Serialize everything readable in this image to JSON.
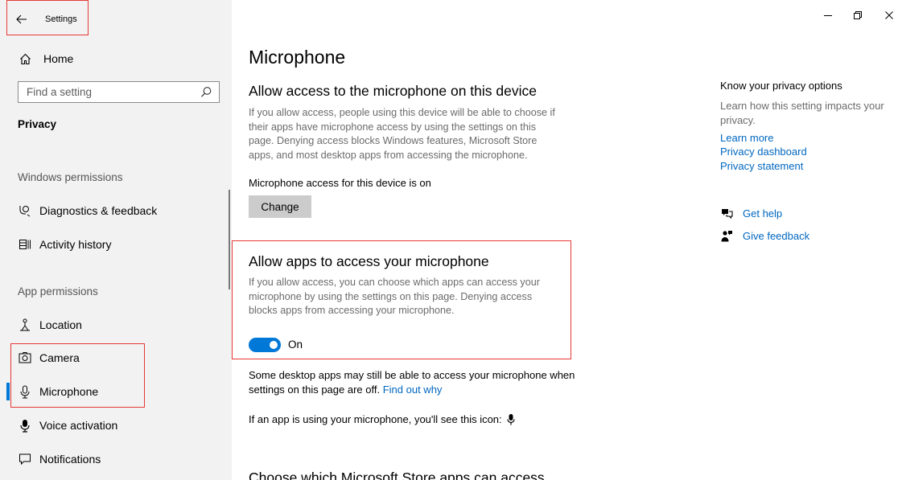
{
  "window": {
    "title": "Settings",
    "back_icon": "back-arrow-icon",
    "controls": [
      "minimize-icon",
      "restore-icon",
      "close-icon"
    ]
  },
  "sidebar": {
    "home_label": "Home",
    "search_placeholder": "Find a setting",
    "section_title": "Privacy",
    "groups": [
      {
        "label": "Windows permissions",
        "items": [
          {
            "label": "Diagnostics & feedback",
            "icon": "diagnostics-icon"
          },
          {
            "label": "Activity history",
            "icon": "activity-history-icon"
          }
        ]
      },
      {
        "label": "App permissions",
        "items": [
          {
            "label": "Location",
            "icon": "location-icon"
          },
          {
            "label": "Camera",
            "icon": "camera-icon"
          },
          {
            "label": "Microphone",
            "icon": "microphone-icon",
            "selected": true
          },
          {
            "label": "Voice activation",
            "icon": "voice-activation-icon"
          },
          {
            "label": "Notifications",
            "icon": "notifications-icon"
          }
        ]
      }
    ]
  },
  "main": {
    "page_title": "Microphone",
    "device_section": {
      "heading": "Allow access to the microphone on this device",
      "description": "If you allow access, people using this device will be able to choose if their apps have microphone access by using the settings on this page. Denying access blocks Windows features, Microsoft Store apps, and most desktop apps from accessing the microphone.",
      "status": "Microphone access for this device is on",
      "change_button": "Change"
    },
    "apps_section": {
      "heading": "Allow apps to access your microphone",
      "description": "If you allow access, you can choose which apps can access your microphone by using the settings on this page. Denying access blocks apps from accessing your microphone.",
      "toggle_on": true,
      "toggle_label": "On"
    },
    "desktop_note": "Some desktop apps may still be able to access your microphone when settings on this page are off.",
    "find_out_why": "Find out why",
    "icon_note": "If an app is using your microphone, you'll see this icon:",
    "next_heading": "Choose which Microsoft Store apps can access"
  },
  "right_panel": {
    "title": "Know your privacy options",
    "description": "Learn how this setting impacts your privacy.",
    "links": [
      "Learn more",
      "Privacy dashboard",
      "Privacy statement"
    ],
    "get_help": "Get help",
    "give_feedback": "Give feedback"
  },
  "colors": {
    "accent": "#0078d7",
    "link": "#0067c0",
    "highlight_box": "#e53935",
    "sidebar_bg": "#f2f2f2"
  }
}
